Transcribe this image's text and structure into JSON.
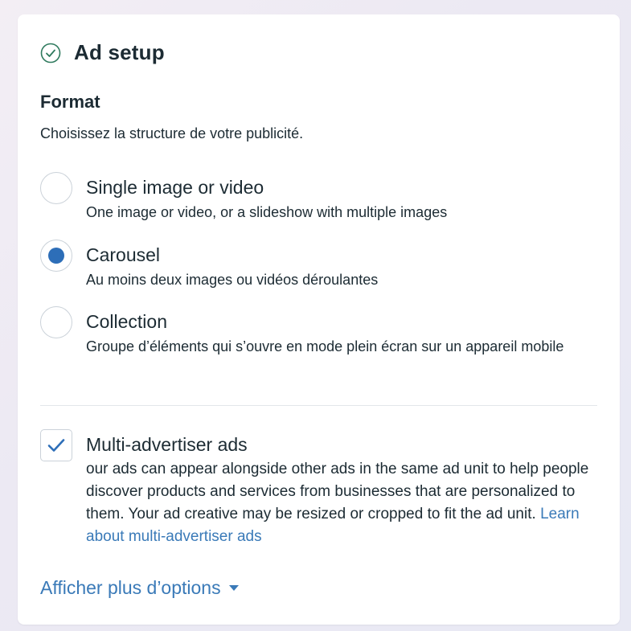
{
  "header": {
    "title": "Ad setup",
    "icon": "check-circle-icon",
    "icon_color": "#2f7a5e"
  },
  "format": {
    "title": "Format",
    "description": "Choisissez la structure de votre publicité.",
    "options": [
      {
        "label": "Single image or video",
        "sub": "One image or video, or a slideshow with multiple images",
        "selected": false
      },
      {
        "label": "Carousel",
        "sub": "Au moins deux images ou vidéos déroulantes",
        "selected": true
      },
      {
        "label": "Collection",
        "sub": "Groupe d’éléments qui s’ouvre en mode plein écran sur un appareil mobile",
        "selected": false
      }
    ]
  },
  "multi_advertiser": {
    "label": "Multi-advertiser ads",
    "checked": true,
    "description": "our ads can appear alongside other ads in the same ad unit to help people discover products and services from businesses that are personalized to them. Your ad creative may be resized or cropped to fit the ad unit.",
    "link_text": "Learn about multi-advertiser ads"
  },
  "more_options": {
    "label": "Afficher plus d’options",
    "icon": "caret-down-icon"
  },
  "colors": {
    "accent": "#2d6eb8",
    "link": "#3a7ab8",
    "text": "#1c2b33"
  }
}
